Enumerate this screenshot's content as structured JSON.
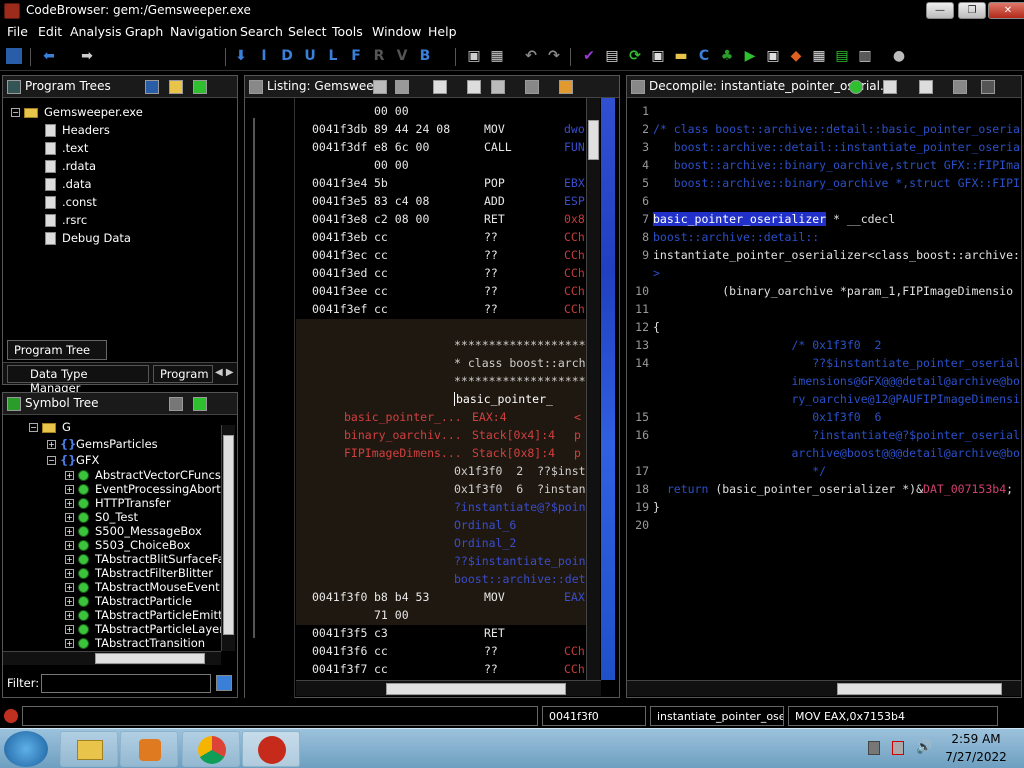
{
  "window": {
    "title": "CodeBrowser: gem:/Gemsweeper.exe",
    "min": "—",
    "max": "❐",
    "close": "✕"
  },
  "menu": [
    "File",
    "Edit",
    "Analysis",
    "Graph",
    "Navigation",
    "Search",
    "Select",
    "Tools",
    "Window",
    "Help"
  ],
  "toolbar": {
    "letters": [
      "I",
      "D",
      "U",
      "L",
      "F",
      "R",
      "V",
      "B"
    ]
  },
  "program_trees": {
    "title": "Program Trees",
    "root": "Gemsweeper.exe",
    "items": [
      "Headers",
      ".text",
      ".rdata",
      ".data",
      ".const",
      ".rsrc",
      "Debug Data"
    ],
    "tabs": [
      "Program Tree",
      "Data Type Manager",
      "Program T"
    ]
  },
  "symbol_tree": {
    "title": "Symbol Tree",
    "root": "G",
    "namespaces": [
      "GemsParticles",
      "GFX"
    ],
    "classes": [
      "AbstractVectorCFuncsI",
      "EventProcessingAbortE",
      "HTTPTransfer",
      "S0_Test",
      "S500_MessageBox",
      "S503_ChoiceBox",
      "TAbstractBlitSurfaceFa",
      "TAbstractFilterBlitter",
      "TAbstractMouseEvent",
      "TAbstractParticle",
      "TAbstractParticleEmitte",
      "TAbstractParticleLayer",
      "TAbstractTransition"
    ],
    "filter_label": "Filter:"
  },
  "listing": {
    "title": "Listing:  Gemswee...",
    "rows_top": [
      {
        "addr": "",
        "bytes": "00 00",
        "mn": "",
        "op": ""
      },
      {
        "addr": "0041f3db",
        "bytes": "89 44 24 08",
        "mn": "MOV",
        "op": "dwo"
      },
      {
        "addr": "0041f3df",
        "bytes": "e8 6c 00",
        "mn": "CALL",
        "op": "FUN"
      },
      {
        "addr": "",
        "bytes": "00 00",
        "mn": "",
        "op": ""
      },
      {
        "addr": "0041f3e4",
        "bytes": "5b",
        "mn": "POP",
        "op": "EBX"
      },
      {
        "addr": "0041f3e5",
        "bytes": "83 c4 08",
        "mn": "ADD",
        "op": "ESP"
      },
      {
        "addr": "0041f3e8",
        "bytes": "c2 08 00",
        "mn": "RET",
        "op": "0x8"
      },
      {
        "addr": "0041f3eb",
        "bytes": "cc",
        "mn": "??",
        "op": "CCh"
      },
      {
        "addr": "0041f3ec",
        "bytes": "cc",
        "mn": "??",
        "op": "CCh"
      },
      {
        "addr": "0041f3ed",
        "bytes": "cc",
        "mn": "??",
        "op": "CCh"
      },
      {
        "addr": "0041f3ee",
        "bytes": "cc",
        "mn": "??",
        "op": "CCh"
      },
      {
        "addr": "0041f3ef",
        "bytes": "cc",
        "mn": "??",
        "op": "CCh"
      }
    ],
    "stars1": "********************",
    "class_comment": "* class boost::arch",
    "stars2": "********************",
    "func_name": "basic_pointer_",
    "params": [
      {
        "type": "basic_pointer_...",
        "loc": "EAX:4",
        "extra": "<"
      },
      {
        "type": "binary_oarchiv...",
        "loc": "Stack[0x4]:4",
        "extra": "p"
      },
      {
        "type": "FIPImageDimens...",
        "loc": "Stack[0x8]:4",
        "extra": "p"
      }
    ],
    "xrefs": [
      "0x1f3f0  2  ??$inst",
      "0x1f3f0  6  ?instan",
      "?instantiate@?$poin",
      "Ordinal_6",
      "Ordinal_2",
      "??$instantiate_poin",
      "boost::archive::det"
    ],
    "rows_bottom": [
      {
        "addr": "0041f3f0",
        "bytes": "b8 b4 53",
        "mn": "MOV",
        "op": "EAX"
      },
      {
        "addr": "",
        "bytes": "71 00",
        "mn": "",
        "op": ""
      },
      {
        "addr": "0041f3f5",
        "bytes": "c3",
        "mn": "RET",
        "op": ""
      },
      {
        "addr": "0041f3f6",
        "bytes": "cc",
        "mn": "??",
        "op": "CCh"
      },
      {
        "addr": "0041f3f7",
        "bytes": "cc",
        "mn": "??",
        "op": "CCh"
      }
    ]
  },
  "decompile": {
    "title": "Decompile: instantiate_pointer_oserial...",
    "lines": [
      {
        "n": "1",
        "t": "",
        "c": "fn"
      },
      {
        "n": "2",
        "t": "/* class boost::archive::detail::basic_pointer_oseria",
        "c": "cm"
      },
      {
        "n": "3",
        "t": "   boost::archive::detail::instantiate_pointer_oseria",
        "c": "cm"
      },
      {
        "n": "4",
        "t": "   boost::archive::binary_oarchive,struct GFX::FIPIma",
        "c": "cm"
      },
      {
        "n": "5",
        "t": "   boost::archive::binary_oarchive *,struct GFX::FIPI",
        "c": "cm"
      },
      {
        "n": "6",
        "t": "",
        "c": "fn"
      },
      {
        "n": "7",
        "t": "HIGHLIGHT",
        "c": "fn"
      },
      {
        "n": "8",
        "t": "boost::archive::detail::",
        "c": "typ"
      },
      {
        "n": "9",
        "t": "instantiate_pointer_oserializer<class_boost::archive:",
        "c": "fn"
      },
      {
        "n": "",
        "t": ">",
        "c": "typ"
      },
      {
        "n": "10",
        "t": "          (binary_oarchive *param_1,FIPImageDimensio",
        "c": "fn"
      },
      {
        "n": "11",
        "t": "",
        "c": "fn"
      },
      {
        "n": "12",
        "t": "{",
        "c": "fn"
      },
      {
        "n": "13",
        "t": "                    /* 0x1f3f0  2",
        "c": "cm"
      },
      {
        "n": "14",
        "t": "                       ??$instantiate_pointer_oserial",
        "c": "cm"
      },
      {
        "n": "",
        "t": "                    imensions@GFX@@@detail@archive@bo",
        "c": "cm"
      },
      {
        "n": "",
        "t": "                    ry_oarchive@12@PAUFIPImageDimensi",
        "c": "cm"
      },
      {
        "n": "15",
        "t": "                       0x1f3f0  6",
        "c": "cm"
      },
      {
        "n": "16",
        "t": "                       ?instantiate@?$pointer_oserial",
        "c": "cm"
      },
      {
        "n": "",
        "t": "                    archive@boost@@@detail@archive@bo",
        "c": "cm"
      },
      {
        "n": "17",
        "t": "                       */",
        "c": "cm"
      },
      {
        "n": "18",
        "t": "RETURN",
        "c": "fn"
      },
      {
        "n": "19",
        "t": "}",
        "c": "fn"
      },
      {
        "n": "20",
        "t": "",
        "c": "fn"
      }
    ],
    "highlight_word": "basic_pointer_oserializer",
    "highlight_rest": " * __cdecl",
    "return_kw": "  return ",
    "return_mid": "(basic_pointer_oserializer *)&",
    "return_glob": "DAT_007153b4",
    "return_end": ";"
  },
  "status": {
    "addr": "0041f3f0",
    "func": "instantiate_pointer_ose...",
    "instr": "MOV EAX,0x7153b4"
  },
  "taskbar": {
    "time": "2:59 AM",
    "date": "7/27/2022"
  }
}
